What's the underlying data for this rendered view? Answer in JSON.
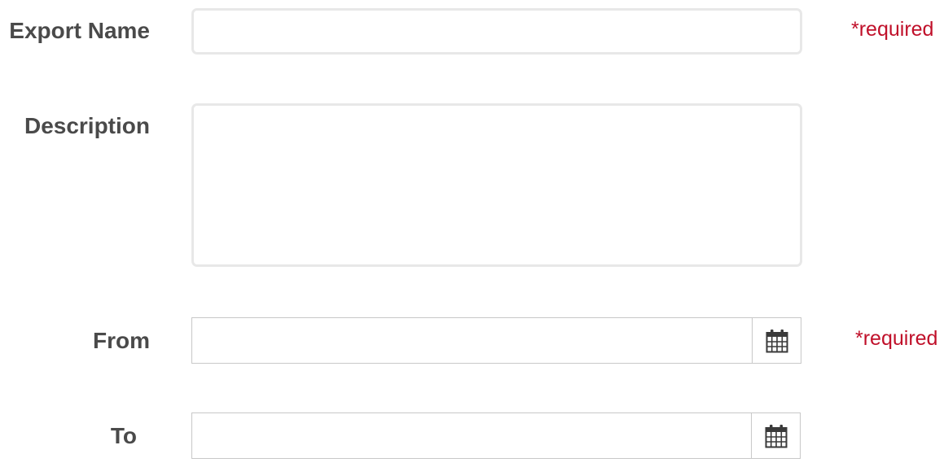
{
  "form": {
    "export_name": {
      "label": "Export Name",
      "value": "",
      "placeholder": "",
      "required_text": "*required"
    },
    "description": {
      "label": "Description",
      "value": "",
      "placeholder": ""
    },
    "from": {
      "label": "From",
      "value": "",
      "placeholder": "",
      "required_text": "*required",
      "icon": "calendar-icon"
    },
    "to": {
      "label": "To",
      "value": "",
      "placeholder": "",
      "icon": "calendar-icon"
    }
  },
  "colors": {
    "label": "#4a4a4a",
    "required": "#c0102a",
    "input_border": "#e8e8e8",
    "date_border": "#c8c8c8",
    "icon": "#3a3a3a"
  }
}
